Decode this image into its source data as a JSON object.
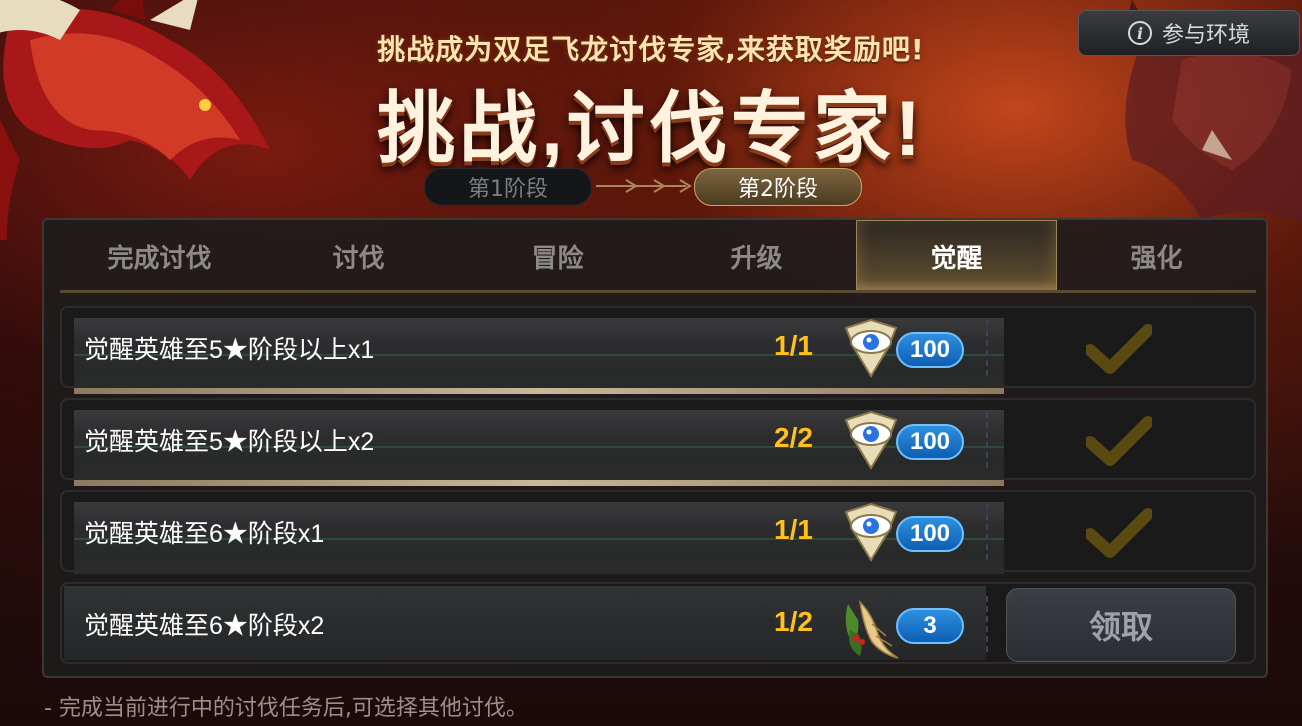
{
  "header": {
    "subtitle": "挑战成为双足飞龙讨伐专家,来获取奖励吧!",
    "title": "挑战,讨伐专家!",
    "env_button_label": "参与环境"
  },
  "stages": [
    {
      "label": "第1阶段",
      "active": false
    },
    {
      "label": "第2阶段",
      "active": true
    }
  ],
  "tabs": [
    {
      "label": "完成讨伐",
      "active": false
    },
    {
      "label": "讨伐",
      "active": false
    },
    {
      "label": "冒险",
      "active": false
    },
    {
      "label": "升级",
      "active": false
    },
    {
      "label": "觉醒",
      "active": true
    },
    {
      "label": "强化",
      "active": false
    }
  ],
  "tasks": [
    {
      "text": "觉醒英雄至5★阶段以上x1",
      "progress": "1/1",
      "reward_icon": "eye-gem-icon",
      "reward_count": "100",
      "status": "completed"
    },
    {
      "text": "觉醒英雄至5★阶段以上x2",
      "progress": "2/2",
      "reward_icon": "eye-gem-icon",
      "reward_count": "100",
      "status": "completed"
    },
    {
      "text": "觉醒英雄至6★阶段x1",
      "progress": "1/1",
      "reward_icon": "eye-gem-icon",
      "reward_count": "100",
      "status": "completed"
    },
    {
      "text": "觉醒英雄至6★阶段x2",
      "progress": "1/2",
      "reward_icon": "ginseng-icon",
      "reward_count": "3",
      "status": "in-progress",
      "button_label": "领取"
    }
  ],
  "footnote": "- 完成当前进行中的讨伐任务后,可选择其他讨伐。",
  "colors": {
    "progress": "#ffc21a",
    "tab_active": "#7c6640",
    "reward_badge": "#1a75cc",
    "check": "#5a4a12"
  }
}
